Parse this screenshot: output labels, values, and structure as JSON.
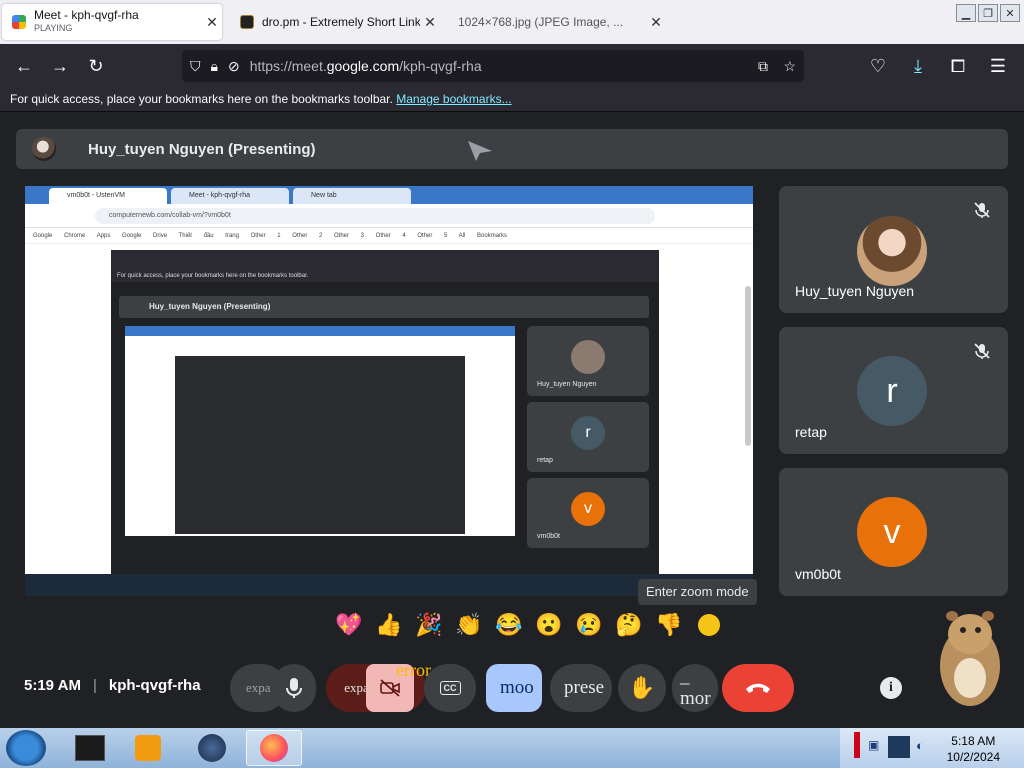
{
  "browser": {
    "tabs": [
      {
        "title": "Meet - kph-qvgf-rha",
        "subtitle": "PLAYING",
        "active": true
      },
      {
        "title": "dro.pm - Extremely Short Links",
        "active": false
      },
      {
        "title": "1024×768.jpg (JPEG Image, ...",
        "active": false
      }
    ],
    "url_prefix": "https://meet.",
    "url_domain": "google.com",
    "url_path": "/kph-qvgf-rha",
    "bookmarks_text": "For quick access, place your bookmarks here on the bookmarks toolbar.",
    "bookmarks_link": "Manage bookmarks..."
  },
  "meet": {
    "presenter_label": "Huy_tuyen Nguyen (Presenting)",
    "shared_screen": {
      "tabs": [
        "vm0b0t - UstenVM",
        "Meet - kph-qvgf-rha",
        "New tab"
      ],
      "address": "computernewb.com/collab-vm/?vm0b0t",
      "bookmarks": "Google Chrome  Apps Google Drive  Thiết đầu trang  Other 1  Other 2  Other 3  Other 4  Other 5  All Bookmarks",
      "inner_bookmarks": "For quick access, place your bookmarks here on the bookmarks toolbar.",
      "inner_presenter": "Huy_tuyen Nguyen (Presenting)",
      "inner_tiles": [
        {
          "name": "Huy_tuyen Nguyen",
          "initial": ""
        },
        {
          "name": "retap",
          "initial": "r"
        },
        {
          "name": "vm0b0t",
          "initial": "v"
        }
      ]
    },
    "participants": [
      {
        "name": "Huy_tuyen Nguyen",
        "initial": "",
        "muted": true
      },
      {
        "name": "retap",
        "initial": "r",
        "muted": true
      },
      {
        "name": "vm0b0t",
        "initial": "v",
        "muted": false
      }
    ],
    "tooltip": "Enter zoom mode",
    "reactions": [
      "💖",
      "👍",
      "🎉",
      "👏",
      "😂",
      "😮",
      "😢",
      "🤔",
      "👎"
    ],
    "time": "5:19 AM",
    "meeting_code": "kph-qvgf-rha",
    "controls": {
      "expand_left": "expa",
      "expand_more": "expand_less",
      "error": "error",
      "mood": "moo",
      "present": "prese",
      "more": "_ mor"
    }
  },
  "taskbar": {
    "clock_time": "5:18 AM",
    "clock_date": "10/2/2024"
  },
  "colors": {
    "meet_bg": "#202124",
    "tile_bg": "#3c4043",
    "hangup_red": "#ea4335",
    "retap_avatar": "#455a64",
    "vm_avatar": "#e8710a",
    "mood_button": "#a8c7fa"
  }
}
